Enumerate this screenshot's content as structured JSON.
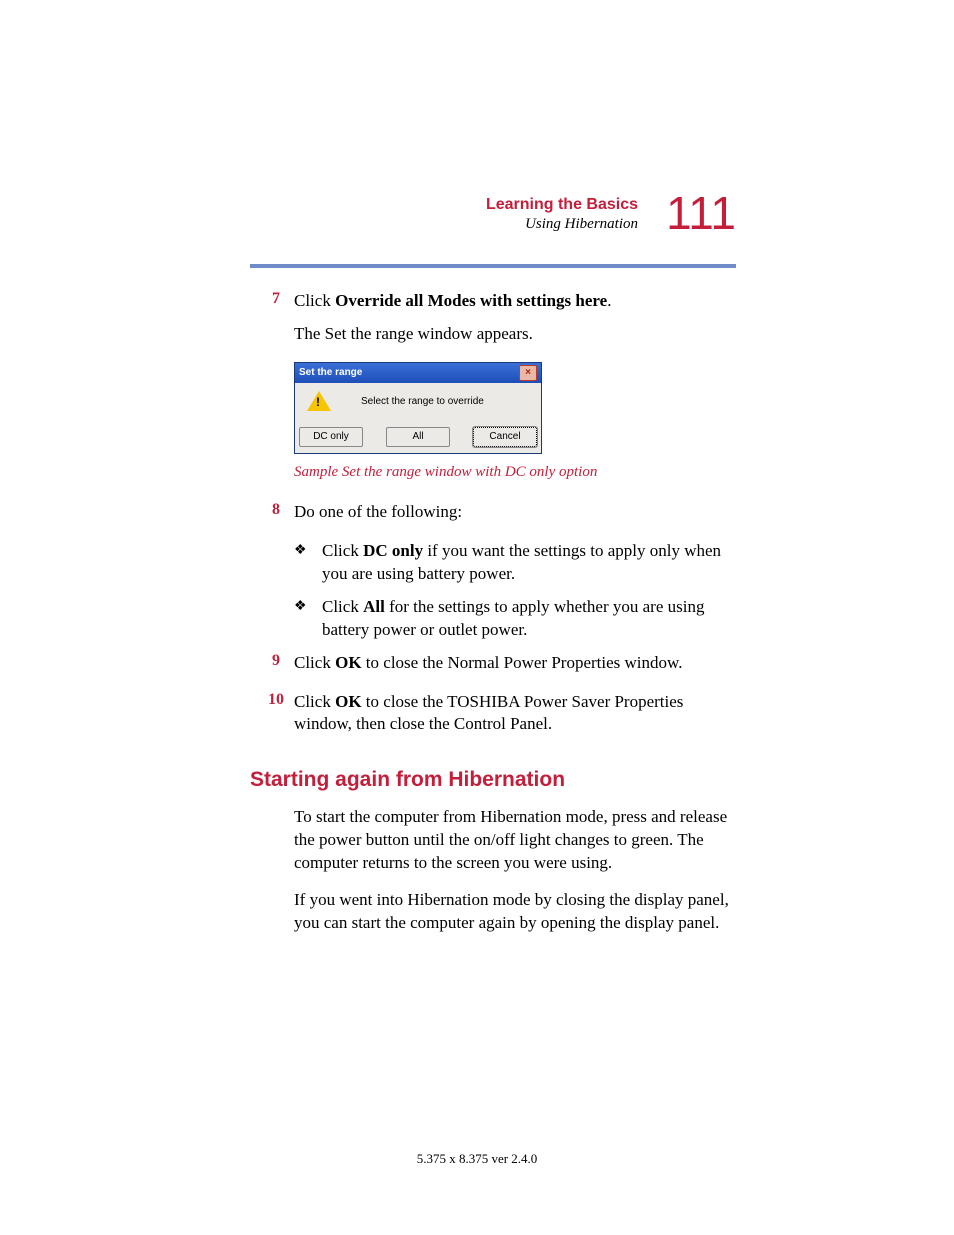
{
  "header": {
    "chapter": "Learning the Basics",
    "section": "Using Hibernation",
    "page_number": "111"
  },
  "steps": {
    "s7": {
      "num": "7",
      "pre": "Click ",
      "bold": "Override all Modes with settings here",
      "post": ".",
      "cont": "The Set the range window appears."
    },
    "s8": {
      "num": "8",
      "text": "Do one of the following:"
    },
    "b1": {
      "pre": "Click ",
      "bold": "DC only",
      "post": " if you want the settings to apply only when you are using battery power."
    },
    "b2": {
      "pre": "Click ",
      "bold": "All",
      "post": " for the settings to apply whether you are using battery power or outlet power."
    },
    "s9": {
      "num": "9",
      "pre": "Click ",
      "bold": "OK",
      "post": " to close the Normal Power Properties window."
    },
    "s10": {
      "num": "10",
      "pre": "Click ",
      "bold": "OK",
      "post": " to close the TOSHIBA Power Saver Properties window, then close the Control Panel."
    }
  },
  "dialog": {
    "title": "Set the range",
    "message": "Select the range to override",
    "btn_dc": "DC only",
    "btn_all": "All",
    "btn_cancel": "Cancel"
  },
  "caption": "Sample Set the range window with DC only option",
  "heading2": "Starting again from Hibernation",
  "para1": "To start the computer from Hibernation mode, press and release the power button until the on/off light changes to green. The computer returns to the screen you were using.",
  "para2": "If you went into Hibernation mode by closing the display panel, you can start the computer again by opening the display panel.",
  "footer": "5.375 x 8.375 ver 2.4.0"
}
